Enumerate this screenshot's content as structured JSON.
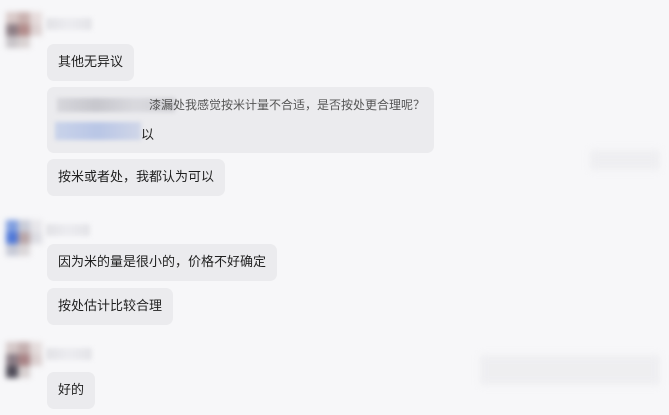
{
  "messages": {
    "m1": "其他无异议",
    "quote_text": "漆漏处我感觉按米计量不合适，是否按处更合理呢？",
    "quote_reply_tail": "以",
    "m2": "按米或者处，我都认为可以",
    "m3": "因为米的量是很小的，价格不好确定",
    "m4": "按处估计比较合理",
    "m5": "好的"
  },
  "colors": {
    "background": "#f7f7f9",
    "bubble": "#ebebee"
  }
}
